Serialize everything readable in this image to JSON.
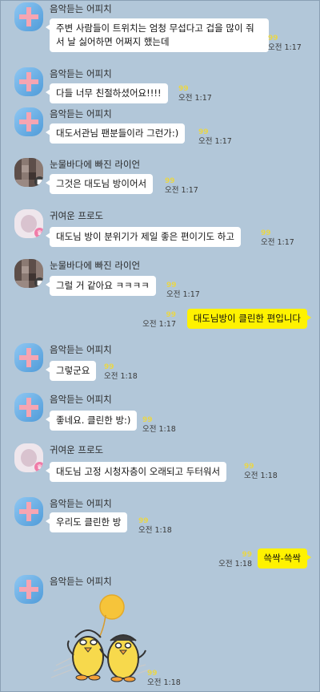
{
  "senders": {
    "apeach": "음악듣는 어피치",
    "ryan": "눈물바다에 빠진 라이언",
    "frodo": "귀여운 프로도"
  },
  "unread_marker": "99",
  "messages": [
    {
      "text": "주변 사람들이 트위치는 엄청 무섭다고 겁을 많이 줘서 날 싫어하면 어쩌지 했는데",
      "time": "오전 1:17"
    },
    {
      "text": "다들 너무 친절하셨어요!!!!",
      "time": "오전 1:17"
    },
    {
      "text": "대도서관님 팬분들이라 그런가:)",
      "time": "오전 1:17"
    },
    {
      "text": "그것은 대도님 방이어서",
      "time": "오전 1:17"
    },
    {
      "text": "대도님 방이 분위기가 제일 좋은 편이기도 하고",
      "time": "오전 1:17"
    },
    {
      "text": "그럴 거 같아요 ㅋㅋㅋㅋ",
      "time": "오전 1:17"
    },
    {
      "text": "대도님방이 클린한 편입니다",
      "time": "오전 1:17"
    },
    {
      "text": "그렇군요",
      "time": "오전 1:18"
    },
    {
      "text": "좋네요. 클린한 방:)",
      "time": "오전 1:18"
    },
    {
      "text": "대도님 고정 시청자층이 오래되고 두터워서",
      "time": "오전 1:18"
    },
    {
      "text": "우리도 클린한 방",
      "time": "오전 1:18"
    },
    {
      "text": "쓱싹-쓱싹",
      "time": "오전 1:18"
    },
    {
      "text": "",
      "time": "오전 1:18"
    }
  ],
  "colors": {
    "background": "#b2c7d9",
    "my_bubble": "#fff200",
    "other_bubble": "#ffffff",
    "unread": "#e8d64a"
  },
  "icons": {
    "camera_badge": "camera-icon",
    "crown_badge": "crown-icon",
    "sticker": "kakao-sticker"
  }
}
